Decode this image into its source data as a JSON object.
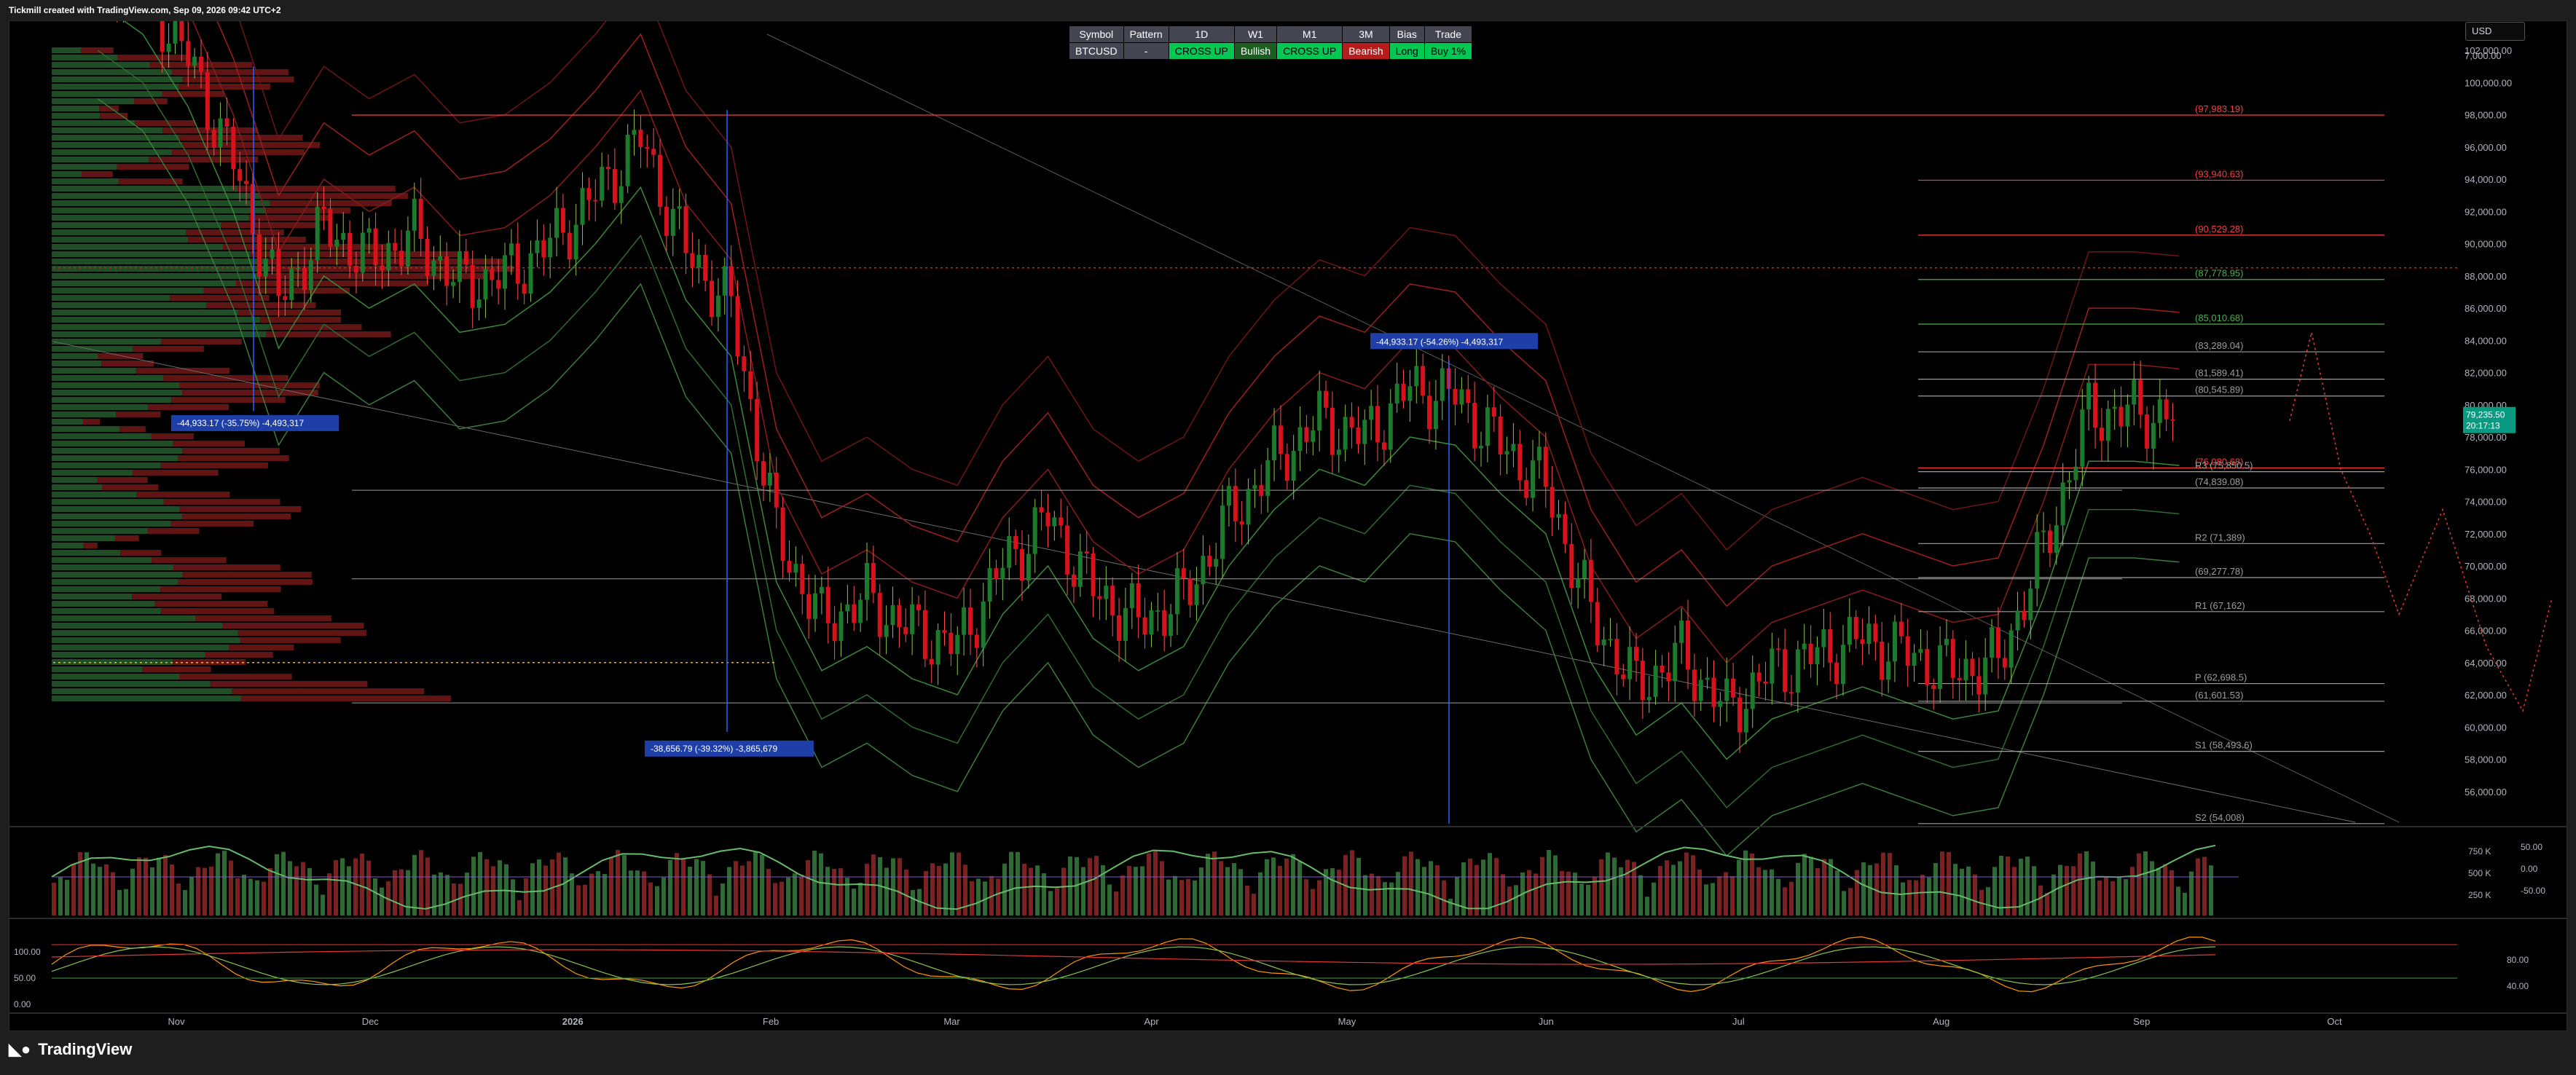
{
  "header": {
    "credit": "Tickmill created with TradingView.com, Sep 09, 2026 09:42 UTC+2"
  },
  "currency": "USD",
  "brand": {
    "name": "TradingView",
    "icon": "tradingview-logo-icon"
  },
  "status_table": {
    "headers": [
      "Symbol",
      "Pattern",
      "1D",
      "W1",
      "M1",
      "3M",
      "Bias",
      "Trade"
    ],
    "values": [
      "BTCUSD",
      "-",
      "CROSS UP",
      "Bullish",
      "CROSS UP",
      "Bearish",
      "Long",
      "Buy 1%"
    ],
    "styles": [
      "sym",
      "neutral",
      "green",
      "dgreen",
      "green",
      "red",
      "green",
      "green"
    ]
  },
  "colors": {
    "bull": "#1b7a2b",
    "bear": "#d8121a",
    "bull_vol": "#2e6b34",
    "bear_vol": "#7a2121",
    "accent_blue": "#2962ff",
    "price_badge": "#089981"
  },
  "chart_data": {
    "type": "candlestick",
    "symbol": "BTCUSD",
    "x_ticks": [
      "Nov",
      "Dec",
      "2026",
      "Feb",
      "Mar",
      "Apr",
      "May",
      "Jun",
      "Jul",
      "Aug",
      "Sep",
      "Oct"
    ],
    "y_ticks": [
      "56,000.00",
      "58,000.00",
      "60,000.00",
      "62,000.00",
      "64,000.00",
      "66,000.00",
      "68,000.00",
      "70,000.00",
      "72,000.00",
      "74,000.00",
      "76,000.00",
      "78,000.00",
      "80,000.00",
      "82,000.00",
      "84,000.00",
      "86,000.00",
      "88,000.00",
      "90,000.00",
      "92,000.00",
      "94,000.00",
      "96,000.00",
      "98,000.00",
      "100,000.00",
      "102,000.00"
    ],
    "y_top_label": "7,000.00",
    "ylim": [
      54000,
      103000
    ],
    "current_price": {
      "label": "79,235.50",
      "countdown": "20:17:13",
      "value": 79235.5
    },
    "close_series": [
      {
        "date": "2025-10-20",
        "close": 108000
      },
      {
        "date": "2025-10-27",
        "close": 106000
      },
      {
        "date": "2025-11-03",
        "close": 101500
      },
      {
        "date": "2025-11-10",
        "close": 95000
      },
      {
        "date": "2025-11-17",
        "close": 86500
      },
      {
        "date": "2025-11-24",
        "close": 91000
      },
      {
        "date": "2025-12-01",
        "close": 89000
      },
      {
        "date": "2025-12-08",
        "close": 90500
      },
      {
        "date": "2025-12-15",
        "close": 87500
      },
      {
        "date": "2025-12-22",
        "close": 88000
      },
      {
        "date": "2025-12-29",
        "close": 90000
      },
      {
        "date": "2026-01-05",
        "close": 93000
      },
      {
        "date": "2026-01-12",
        "close": 96500
      },
      {
        "date": "2026-01-19",
        "close": 89500
      },
      {
        "date": "2026-01-26",
        "close": 86000
      },
      {
        "date": "2026-02-02",
        "close": 72000
      },
      {
        "date": "2026-02-09",
        "close": 66500
      },
      {
        "date": "2026-02-16",
        "close": 68000
      },
      {
        "date": "2026-02-23",
        "close": 66000
      },
      {
        "date": "2026-03-02",
        "close": 65000
      },
      {
        "date": "2026-03-09",
        "close": 70000
      },
      {
        "date": "2026-03-16",
        "close": 73000
      },
      {
        "date": "2026-03-23",
        "close": 68500
      },
      {
        "date": "2026-03-30",
        "close": 66500
      },
      {
        "date": "2026-04-06",
        "close": 68000
      },
      {
        "date": "2026-04-13",
        "close": 73000
      },
      {
        "date": "2026-04-20",
        "close": 76500
      },
      {
        "date": "2026-04-27",
        "close": 79000
      },
      {
        "date": "2026-05-04",
        "close": 78000
      },
      {
        "date": "2026-05-11",
        "close": 81000
      },
      {
        "date": "2026-05-18",
        "close": 80500
      },
      {
        "date": "2026-05-25",
        "close": 77500
      },
      {
        "date": "2026-06-01",
        "close": 75000
      },
      {
        "date": "2026-06-08",
        "close": 67000
      },
      {
        "date": "2026-06-15",
        "close": 62500
      },
      {
        "date": "2026-06-22",
        "close": 64500
      },
      {
        "date": "2026-06-29",
        "close": 61000
      },
      {
        "date": "2026-07-06",
        "close": 63500
      },
      {
        "date": "2026-07-13",
        "close": 64500
      },
      {
        "date": "2026-07-20",
        "close": 65500
      },
      {
        "date": "2026-07-27",
        "close": 64500
      },
      {
        "date": "2026-08-03",
        "close": 63500
      },
      {
        "date": "2026-08-10",
        "close": 64000
      },
      {
        "date": "2026-08-17",
        "close": 71000
      },
      {
        "date": "2026-08-24",
        "close": 79500
      },
      {
        "date": "2026-08-31",
        "close": 79500
      },
      {
        "date": "2026-09-07",
        "close": 79235.5
      }
    ],
    "horizontal_levels": [
      {
        "label": "(97,983.19)",
        "value": 97983.19,
        "color": "#ff3b3b"
      },
      {
        "label": "(93,940.63)",
        "value": 93940.63,
        "color": "#ff3b3b"
      },
      {
        "label": "(90,529.28)",
        "value": 90529.28,
        "color": "#ff3b3b"
      },
      {
        "label": "(87,778.95)",
        "value": 87778.95,
        "color": "#4caf50"
      },
      {
        "label": "(85,010.68)",
        "value": 85010.68,
        "color": "#4caf50"
      },
      {
        "label": "(83,289.04)",
        "value": 83289.04,
        "color": "#9e9e9e"
      },
      {
        "label": "(81,589.41)",
        "value": 81589.41,
        "color": "#9e9e9e"
      },
      {
        "label": "(80,545.89)",
        "value": 80545.89,
        "color": "#9e9e9e"
      },
      {
        "label": "(76,080.68)",
        "value": 76080.68,
        "color": "#ff3b3b"
      },
      {
        "label": "R3 (75,850.5)",
        "value": 75850.5,
        "color": "#9e9e9e"
      },
      {
        "label": "(74,839.08)",
        "value": 74839.08,
        "color": "#9e9e9e"
      },
      {
        "label": "R2 (71,389)",
        "value": 71389,
        "color": "#9e9e9e"
      },
      {
        "label": "(69,277.78)",
        "value": 69277.78,
        "color": "#9e9e9e"
      },
      {
        "label": "R1 (67,162)",
        "value": 67162,
        "color": "#9e9e9e"
      },
      {
        "label": "P (62,698.5)",
        "value": 62698.5,
        "color": "#9e9e9e"
      },
      {
        "label": "(61,601.53)",
        "value": 61601.53,
        "color": "#9e9e9e"
      },
      {
        "label": "S1 (58,493.6)",
        "value": 58493.6,
        "color": "#9e9e9e"
      },
      {
        "label": "S2 (54,008)",
        "value": 54008,
        "color": "#9e9e9e"
      }
    ],
    "measurements": [
      {
        "label": "-44,933.17 (-35.75%) -4,493,317"
      },
      {
        "label": "-38,656.79 (-39.32%) -3,865,679"
      },
      {
        "label": "-44,933.17 (-54.26%) -4,493,317"
      }
    ],
    "volume_panel": {
      "y_ticks": [
        "750 K",
        "500 K",
        "250 K"
      ],
      "osc_ticks": [
        "50.00",
        "0.00",
        "-50.00"
      ]
    },
    "stoch_panel": {
      "y_ticks": [
        "100.00",
        "50.00",
        "0.00"
      ],
      "right_ticks": [
        "80.00",
        "40.00"
      ]
    }
  }
}
